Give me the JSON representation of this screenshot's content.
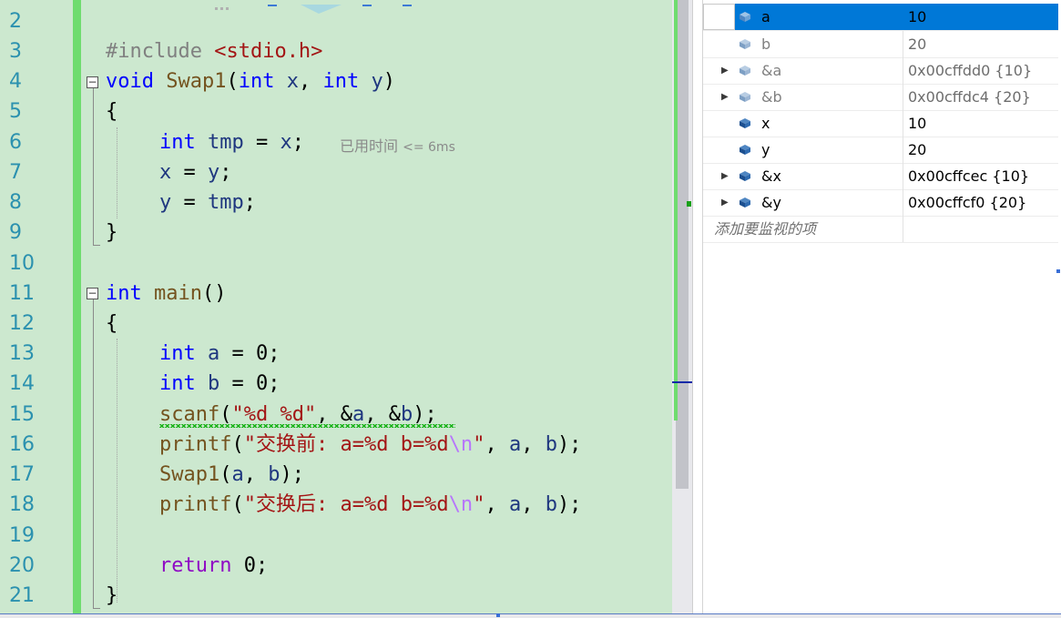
{
  "editor": {
    "line_numbers": [
      "2",
      "3",
      "4",
      "5",
      "6",
      "7",
      "8",
      "9",
      "10",
      "11",
      "12",
      "13",
      "14",
      "15",
      "16",
      "17",
      "18",
      "19",
      "20",
      "21"
    ],
    "elapsed_hint": {
      "label": "已用时间",
      "value": "<= 6ms"
    },
    "code": {
      "l3": {
        "directive": "#include",
        "header": "<stdio.h>"
      },
      "l4": {
        "kw_void": "void",
        "fn": "Swap1",
        "open": "(",
        "kw_int1": "int",
        "p1": "x",
        "comma": ", ",
        "kw_int2": "int",
        "p2": "y",
        "close": ")"
      },
      "l5": "{",
      "l6": {
        "kw": "int",
        "var": "tmp",
        "rest": " = ",
        "rhs": "x",
        "semi": ";"
      },
      "l7": {
        "lhs": "x",
        "op": " = ",
        "rhs": "y",
        "semi": ";"
      },
      "l8": {
        "lhs": "y",
        "op": " = ",
        "rhs": "tmp",
        "semi": ";"
      },
      "l9": "}",
      "l11": {
        "kw": "int",
        "fn": "main",
        "parens": "()"
      },
      "l12": "{",
      "l13": {
        "kw": "int",
        "var": "a",
        "rest": " = 0",
        "semi": ";"
      },
      "l14": {
        "kw": "int",
        "var": "b",
        "rest": " = 0",
        "semi": ";"
      },
      "l15": {
        "fn": "scanf",
        "open": "(",
        "fmt": "\"%d %d\"",
        "sep1": ", &",
        "a": "a",
        "sep2": ", &",
        "b": "b",
        "close": ");"
      },
      "l16": {
        "fn": "printf",
        "open": "(",
        "fmt": "\"交换前: a=%d b=%d",
        "esc": "\\n",
        "quote": "\"",
        "sep1": ", ",
        "a": "a",
        "sep2": ", ",
        "b": "b",
        "close": ");"
      },
      "l17": {
        "fn": "Swap1",
        "open": "(",
        "a": "a",
        "sep": ", ",
        "b": "b",
        "close": ");"
      },
      "l18": {
        "fn": "printf",
        "open": "(",
        "fmt": "\"交换后: a=%d b=%d",
        "esc": "\\n",
        "quote": "\"",
        "sep1": ", ",
        "a": "a",
        "sep2": ", ",
        "b": "b",
        "close": ");"
      },
      "l20": {
        "kw": "return",
        "rest": " 0;"
      },
      "l21": "}"
    }
  },
  "watch": {
    "rows": [
      {
        "name": "a",
        "value": "10",
        "expandable": false,
        "selected": true
      },
      {
        "name": "b",
        "value": "20",
        "expandable": false,
        "selected": false
      },
      {
        "name": "&a",
        "value": "0x00cffdd0 {10}",
        "expandable": true,
        "selected": false
      },
      {
        "name": "&b",
        "value": "0x00cffdc4 {20}",
        "expandable": true,
        "selected": false
      },
      {
        "name": "x",
        "value": "10",
        "expandable": false,
        "selected": false
      },
      {
        "name": "y",
        "value": "20",
        "expandable": false,
        "selected": false
      },
      {
        "name": "&x",
        "value": "0x00cffcec {10}",
        "expandable": true,
        "selected": false
      },
      {
        "name": "&y",
        "value": "0x00cffcf0 {20}",
        "expandable": true,
        "selected": false
      }
    ],
    "add_item_placeholder": "添加要监视的项",
    "icon": "variable-cube-icon",
    "selection_color": "#0078d7"
  },
  "colors": {
    "editor_background": "#cce8cf",
    "change_bar": "#6fdc6f",
    "keyword": "#0000ff",
    "function": "#74531f",
    "string": "#a31515",
    "line_number": "#2b91af"
  }
}
